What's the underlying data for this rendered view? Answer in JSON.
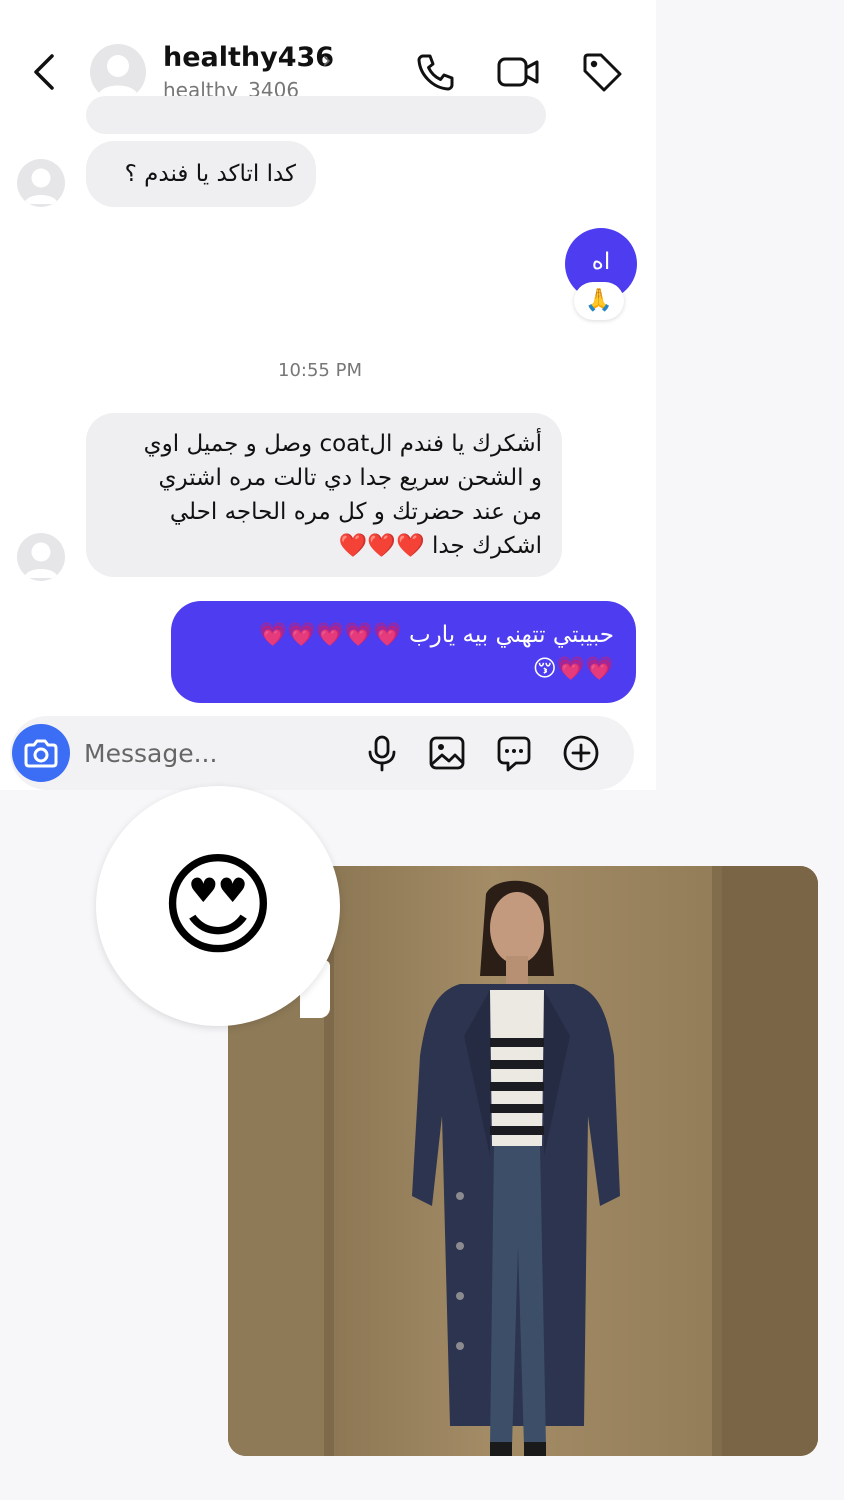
{
  "header": {
    "name": "healthy436",
    "username": "healthy_3406",
    "chevron": "›"
  },
  "icons": {
    "back": "back-arrow-icon",
    "call": "phone-icon",
    "video": "video-camera-icon",
    "tag": "tag-icon",
    "camera": "camera-icon",
    "mic": "microphone-icon",
    "gallery": "image-icon",
    "sticker": "chat-bubble-icon",
    "add": "plus-icon"
  },
  "messages": {
    "m1": "كدا اتاكد يا فندم ؟",
    "m2": "اه",
    "m2_reaction": "🙏",
    "timestamp": "10:55 PM",
    "m3_lines": [
      "أشكرك يا فندم الcoat وصل و جميل اوي",
      "و الشحن سريع جدا دي تالت مره اشتري",
      "من عند حضرتك  و كل مره الحاجه احلي",
      "اشكرك جدا ❤️❤️❤️"
    ],
    "m4_lines": [
      "حبيبتي تتهني بيه يارب 💗💗💗💗💗",
      "💗💗😚"
    ]
  },
  "composer": {
    "placeholder": "Message..."
  },
  "overlay": {
    "reaction_emoji": "😍"
  },
  "colors": {
    "accent": "#4e3df0",
    "camera": "#3b6df5",
    "incoming_bubble": "#efeff2"
  }
}
